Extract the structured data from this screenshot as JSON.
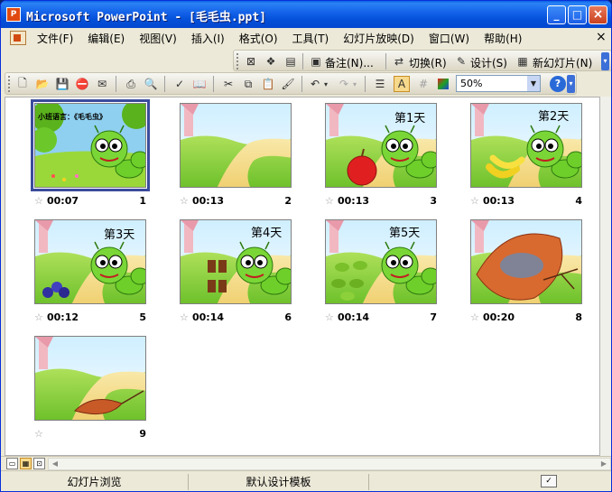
{
  "window": {
    "title": "Microsoft PowerPoint - [毛毛虫.ppt]",
    "icons": {
      "app": "powerpoint-app-icon",
      "minimize": "minimize-icon",
      "maximize": "maximize-icon",
      "close": "close-icon"
    }
  },
  "menubar": {
    "items": [
      {
        "label": "文件(F)"
      },
      {
        "label": "编辑(E)"
      },
      {
        "label": "视图(V)"
      },
      {
        "label": "插入(I)"
      },
      {
        "label": "格式(O)"
      },
      {
        "label": "工具(T)"
      },
      {
        "label": "幻灯片放映(D)"
      },
      {
        "label": "窗口(W)"
      },
      {
        "label": "帮助(H)"
      }
    ],
    "close_glyph": "×"
  },
  "reviewing_toolbar": {
    "notes_label": "备注(N)...",
    "transition_label": "切换(R)",
    "design_label": "设计(S)",
    "new_slide_label": "新幻灯片(N)"
  },
  "standard_toolbar": {
    "zoom": {
      "value": "50%"
    },
    "icons": [
      "new-icon",
      "open-icon",
      "save-icon",
      "permission-icon",
      "email-icon",
      "print-icon",
      "print-preview-icon",
      "spelling-icon",
      "research-icon",
      "cut-icon",
      "copy-icon",
      "paste-icon",
      "format-painter-icon",
      "undo-icon",
      "redo-icon",
      "show-formatting-icon",
      "grayscale-icon",
      "grid-icon",
      "color-icon",
      "help-icon"
    ]
  },
  "slides": [
    {
      "number": "1",
      "time": "00:07",
      "title_text": "小班语言：《毛毛虫》",
      "day_label": "",
      "selected": true
    },
    {
      "number": "2",
      "time": "00:13",
      "title_text": "",
      "day_label": "",
      "selected": false
    },
    {
      "number": "3",
      "time": "00:13",
      "title_text": "",
      "day_label": "第1天",
      "selected": false
    },
    {
      "number": "4",
      "time": "00:13",
      "title_text": "",
      "day_label": "第2天",
      "selected": false
    },
    {
      "number": "5",
      "time": "00:12",
      "title_text": "",
      "day_label": "第3天",
      "selected": false
    },
    {
      "number": "6",
      "time": "00:14",
      "title_text": "",
      "day_label": "第4天",
      "selected": false
    },
    {
      "number": "7",
      "time": "00:14",
      "title_text": "",
      "day_label": "第5天",
      "selected": false
    },
    {
      "number": "8",
      "time": "00:20",
      "title_text": "",
      "day_label": "",
      "selected": false
    },
    {
      "number": "9",
      "time": "",
      "title_text": "",
      "day_label": "",
      "selected": false
    }
  ],
  "statusbar": {
    "view": "幻灯片浏览",
    "template": "默认设计模板"
  }
}
